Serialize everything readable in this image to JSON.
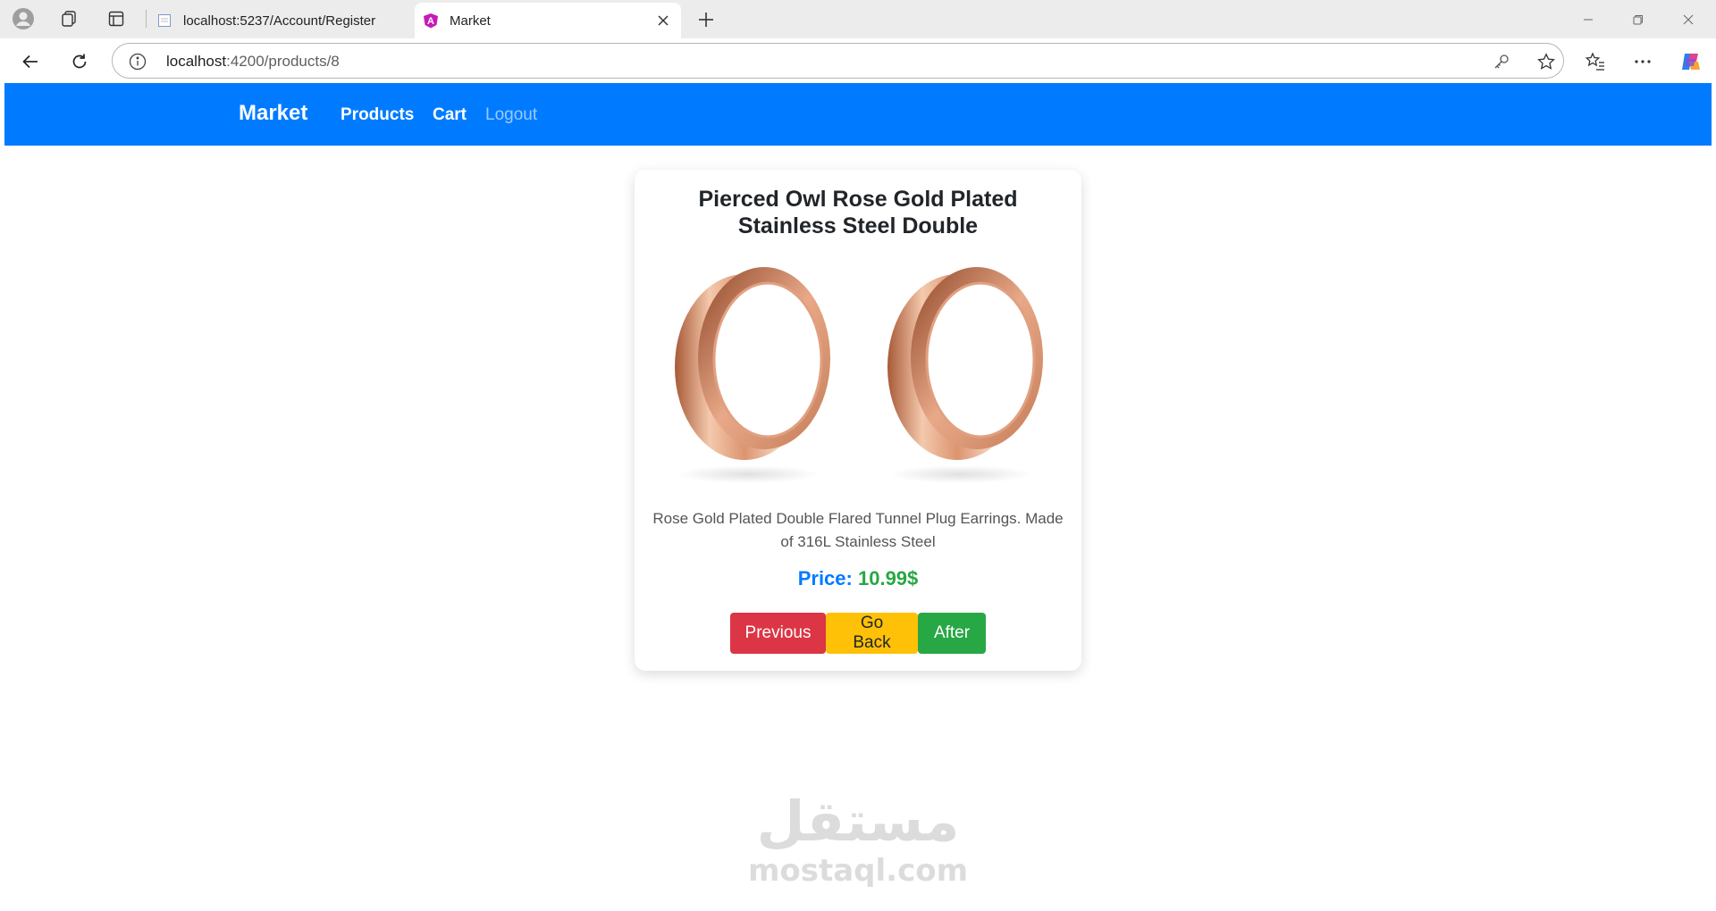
{
  "browser": {
    "tabs": [
      {
        "title": "localhost:5237/Account/Register",
        "active": false
      },
      {
        "title": "Market",
        "active": true
      }
    ],
    "address": {
      "host": "localhost",
      "path": ":4200/products/8"
    }
  },
  "navbar": {
    "brand": "Market",
    "links": [
      "Products",
      "Cart",
      "Logout"
    ],
    "color": "#007bff"
  },
  "product": {
    "title": "Pierced Owl Rose Gold Plated Stainless Steel Double",
    "description": "Rose Gold Plated Double Flared Tunnel Plug Earrings. Made of 316L Stainless Steel",
    "price_label": "Price:",
    "price_value": "10.99$"
  },
  "buttons": {
    "previous": "Previous",
    "go_back": "Go Back",
    "after": "After"
  },
  "watermark": {
    "arabic": "مستقل",
    "latin": "mostaql.com"
  },
  "colors": {
    "danger": "#dc3545",
    "warning": "#ffc107",
    "success": "#28a745",
    "primary": "#007bff"
  }
}
